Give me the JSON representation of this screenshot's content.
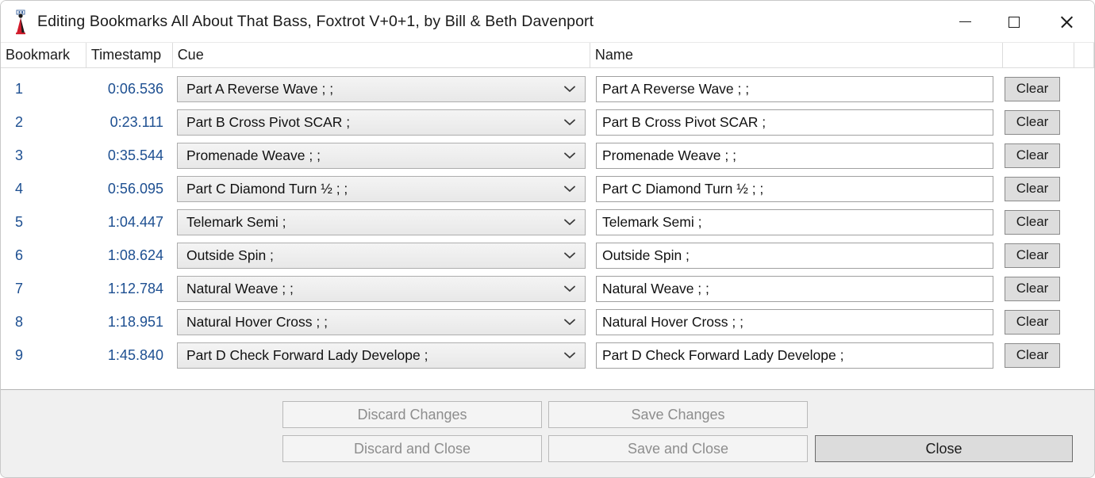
{
  "window": {
    "title": "Editing Bookmarks All About That Bass, Foxtrot V+0+1, by Bill & Beth Davenport",
    "icon": "dancer-icon",
    "controls": {
      "minimize": "minimize-icon",
      "maximize": "maximize-icon",
      "close": "close-icon"
    }
  },
  "colors": {
    "link_blue": "#1d4f91",
    "panel_bg": "#f0f0f0",
    "accent_red": "#d11a2a"
  },
  "table": {
    "headers": {
      "bookmark": "Bookmark",
      "timestamp": "Timestamp",
      "cue": "Cue",
      "name": "Name",
      "clear": "",
      "end": ""
    },
    "clear_label": "Clear",
    "rows": [
      {
        "num": "1",
        "time": "0:06.536",
        "cue": "Part A Reverse Wave ; ;",
        "name": "Part A Reverse Wave ; ;"
      },
      {
        "num": "2",
        "time": "0:23.111",
        "cue": "Part B Cross Pivot SCAR ;",
        "name": "Part B Cross Pivot SCAR ;"
      },
      {
        "num": "3",
        "time": "0:35.544",
        "cue": "Promenade Weave ; ;",
        "name": "Promenade Weave ; ;"
      },
      {
        "num": "4",
        "time": "0:56.095",
        "cue": "Part C Diamond Turn ½ ; ;",
        "name": "Part C Diamond Turn ½ ; ;"
      },
      {
        "num": "5",
        "time": "1:04.447",
        "cue": "Telemark Semi ;",
        "name": "Telemark Semi ;"
      },
      {
        "num": "6",
        "time": "1:08.624",
        "cue": "Outside Spin ;",
        "name": "Outside Spin ;"
      },
      {
        "num": "7",
        "time": "1:12.784",
        "cue": "Natural Weave ; ;",
        "name": "Natural Weave ; ;"
      },
      {
        "num": "8",
        "time": "1:18.951",
        "cue": "Natural Hover Cross ; ;",
        "name": "Natural Hover Cross ; ;"
      },
      {
        "num": "9",
        "time": "1:45.840",
        "cue": "Part D Check Forward Lady Develope ;",
        "name": "Part D Check Forward Lady Develope ;"
      }
    ]
  },
  "footer": {
    "discard_changes": "Discard Changes",
    "save_changes": "Save Changes",
    "discard_and_close": "Discard and Close",
    "save_and_close": "Save and Close",
    "close": "Close"
  }
}
